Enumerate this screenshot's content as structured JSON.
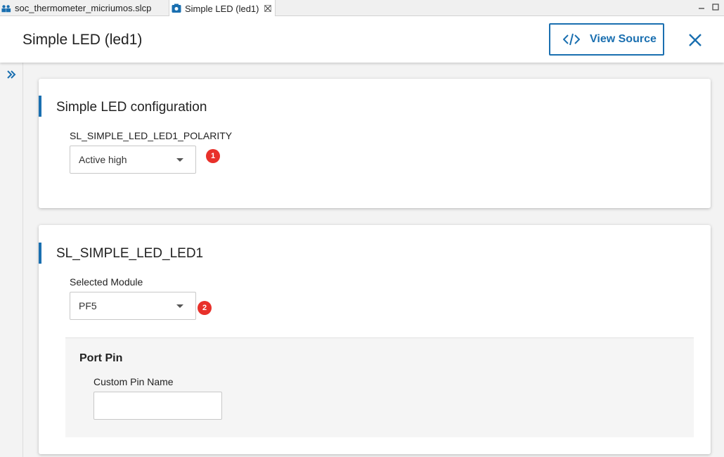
{
  "tabs": [
    {
      "label": "soc_thermometer_micriumos.slcp",
      "icon": "project-icon"
    },
    {
      "label": "Simple LED (led1)",
      "icon": "component-icon",
      "active": true
    }
  ],
  "header": {
    "title": "Simple LED (led1)",
    "view_source_label": "View Source"
  },
  "config_card": {
    "title": "Simple LED configuration",
    "polarity_label": "SL_SIMPLE_LED_LED1_POLARITY",
    "polarity_value": "Active high",
    "badge": "1"
  },
  "led_card": {
    "title": "SL_SIMPLE_LED_LED1",
    "module_label": "Selected Module",
    "module_value": "PF5",
    "badge": "2",
    "port_pin": {
      "title": "Port Pin",
      "custom_pin_label": "Custom Pin Name",
      "custom_pin_value": ""
    }
  },
  "colors": {
    "accent": "#1a6fb0",
    "badge": "#e8302a"
  }
}
